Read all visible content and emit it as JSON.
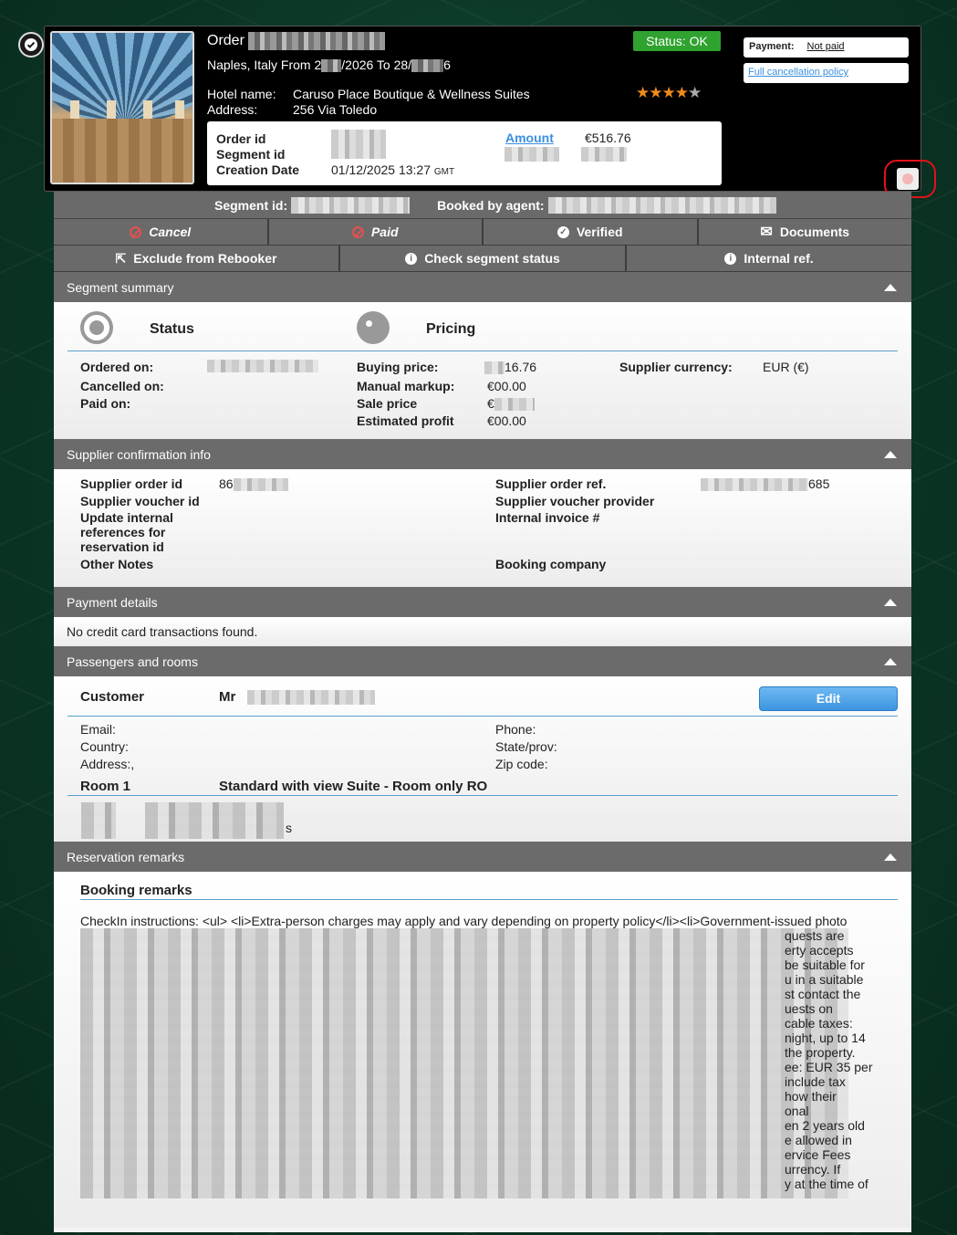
{
  "header": {
    "order_label": "Order",
    "route_prefix": "Naples, Italy From 2",
    "route_mid": "/2026 To 28/",
    "route_suffix": "6",
    "hotel_name_label": "Hotel name:",
    "hotel_name": "Caruso Place Boutique & Wellness Suites",
    "address_label": "Address:",
    "address": "256 Via Toledo",
    "status": "Status: OK",
    "stars": 4,
    "order_id_label": "Order id",
    "segment_id_label": "Segment id",
    "creation_date_label": "Creation Date",
    "creation_date": "01/12/2025 13:27",
    "tz": "GMT",
    "amount_label": "Amount",
    "amount_value": "€516.76",
    "payment_label": "Payment:",
    "payment_value": "Not paid",
    "cancellation_link": "Full cancellation policy"
  },
  "segment_bar": {
    "segment_id_label": "Segment id:",
    "booked_by_label": "Booked by agent:"
  },
  "actions_row1": [
    "Cancel",
    "Paid",
    "Verified",
    "Documents"
  ],
  "actions_row2": [
    "Exclude from Rebooker",
    "Check segment status",
    "Internal ref."
  ],
  "segment_summary": {
    "title": "Segment summary",
    "status_heading": "Status",
    "pricing_heading": "Pricing",
    "ordered_on_label": "Ordered on:",
    "cancelled_on_label": "Cancelled on:",
    "paid_on_label": "Paid on:",
    "buying_price_label": "Buying price:",
    "buying_price_value": "16.76",
    "manual_markup_label": "Manual markup:",
    "manual_markup_value": "€00.00",
    "sale_price_label": "Sale price",
    "sale_price_value": "€",
    "estimated_profit_label": "Estimated profit",
    "estimated_profit_value": "€00.00",
    "supplier_currency_label": "Supplier currency:",
    "supplier_currency_value": "EUR (€)"
  },
  "supplier_info": {
    "title": "Supplier confirmation info",
    "order_id_label": "Supplier order id",
    "order_id_value": "86",
    "voucher_id_label": "Supplier voucher id",
    "update_refs_label": "Update internal references for reservation id",
    "other_notes_label": "Other Notes",
    "order_ref_label": "Supplier order ref.",
    "order_ref_value": "685",
    "voucher_provider_label": "Supplier voucher provider",
    "invoice_label": "Internal invoice #",
    "booking_company_label": "Booking company"
  },
  "payment_details": {
    "title": "Payment details",
    "message": "No credit card transactions found."
  },
  "passengers": {
    "title": "Passengers and rooms",
    "customer_label": "Customer",
    "customer_title": "Mr",
    "edit_label": "Edit",
    "email_label": "Email:",
    "country_label": "Country:",
    "address_label": "Address:,",
    "phone_label": "Phone:",
    "state_label": "State/prov:",
    "zip_label": "Zip code:",
    "room_label": "Room 1",
    "room_desc": "Standard with view Suite - Room only RO",
    "room_tail": "s"
  },
  "remarks": {
    "title": "Reservation remarks",
    "heading": "Booking remarks",
    "first_line": "CheckIn instructions: <ul>  <li>Extra-person charges may apply and vary depending on property policy</li><li>Government-issued photo",
    "tails": [
      "quests are",
      "erty accepts",
      "be suitable for",
      "u in a suitable",
      "st contact the",
      "uests on",
      "cable taxes:",
      "night, up to 14",
      "the property.",
      "ee: EUR 35 per",
      "include tax",
      "how their",
      "onal",
      "en 2 years old",
      "e allowed in",
      "ervice Fees",
      "urrency. If",
      "y at the time of"
    ]
  },
  "colors": {
    "status_ok": "#2fa22f",
    "link": "#3a8fe0",
    "section_header": "#6b6b6b",
    "highlight_ring": "#e0121a",
    "star_on": "#f08a1c"
  }
}
